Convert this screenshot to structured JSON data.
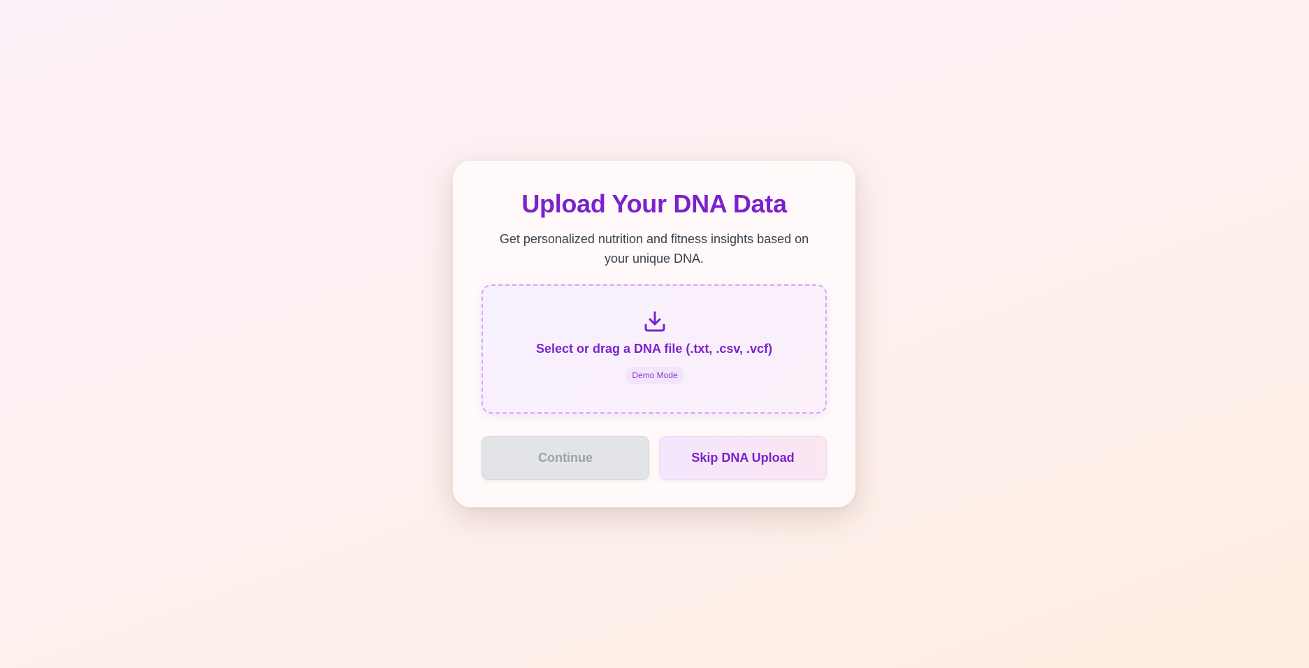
{
  "card": {
    "title": "Upload Your DNA Data",
    "subtitle": "Get personalized nutrition and fitness insights based on your unique DNA."
  },
  "dropzone": {
    "icon": "download-icon",
    "label": "Select or drag a DNA file (.txt, .csv, .vcf)",
    "badge": "Demo Mode"
  },
  "actions": {
    "continue_label": "Continue",
    "continue_disabled": true,
    "skip_label": "Skip DNA Upload"
  },
  "colors": {
    "accent": "#7b22cc",
    "dropzone_border": "#d7a5f6",
    "disabled_bg": "#e3e4e8",
    "disabled_text": "#9ca1ab"
  }
}
